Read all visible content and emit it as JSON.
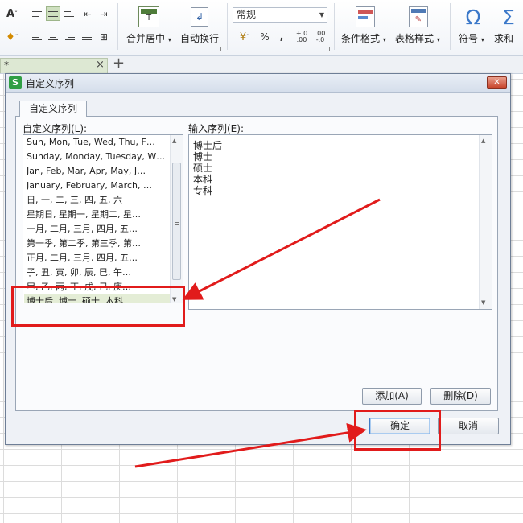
{
  "ribbon": {
    "merge_center_label": "合并居中",
    "wrap_text_label": "自动换行",
    "number_format_value": "常规",
    "percent_symbol": "%",
    "comma_symbol": "⁹",
    "dec_increase": ".0\n.00",
    "dec_decrease": ".00\n.0",
    "conditional_format_label": "条件格式",
    "table_style_label": "表格样式",
    "symbol_label": "符号",
    "sum_label": "求和",
    "omega_glyph": "Ω",
    "sigma_glyph": "Σ"
  },
  "tabstrip": {
    "doc_tab_label": "*",
    "close_glyph": "×",
    "new_tab_glyph": "+"
  },
  "dialog": {
    "title": "自定义序列",
    "app_icon_glyph": "S",
    "close_glyph": "✕",
    "tab_label": "自定义序列",
    "list_label": "自定义序列(L):",
    "input_label": "输入序列(E):",
    "list_items": [
      "Sun, Mon, Tue, Wed, Thu, F…",
      "Sunday, Monday, Tuesday, W…",
      "Jan, Feb, Mar, Apr, May, J…",
      "January, February, March, …",
      "日, 一, 二, 三, 四, 五, 六",
      "星期日, 星期一, 星期二, 星…",
      "一月, 二月, 三月, 四月, 五…",
      "第一季, 第二季, 第三季, 第…",
      "正月, 二月, 三月, 四月, 五…",
      "子, 丑, 寅, 卯, 辰, 巳, 午…",
      "甲, 乙, 丙, 丁, 戊, 己, 庚…",
      "博士后, 博士, 硕士, 本科, …"
    ],
    "selected_index": 11,
    "input_lines": [
      "博士后",
      "博士",
      "硕士",
      "本科",
      "专科"
    ],
    "add_button": "添加(A)",
    "delete_button": "删除(D)",
    "ok_button": "确定",
    "cancel_button": "取消"
  },
  "annotation_color": "#e11b1b"
}
